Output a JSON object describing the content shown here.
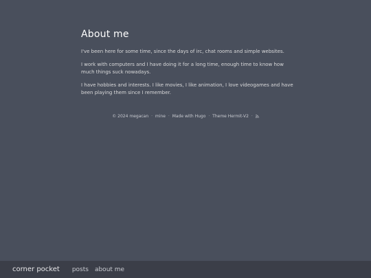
{
  "main": {
    "title": "About me",
    "paragraphs": [
      "I've been here for some time, since the days of irc, chat rooms and simple websites.",
      "I work with computers and I have doing it for a long time, enough time to know how much things suck nowadays.",
      "I have hobbies and interests. I like movies, I like animation, I love videogames and have been playing them since I remember."
    ]
  },
  "footer": {
    "copyright": "© 2024 megacan",
    "sep": "·",
    "mine": "mine",
    "made_with": "Made with Hugo",
    "theme": "Theme Hermit-V2"
  },
  "bottom_bar": {
    "site_title": "corner pocket",
    "nav": [
      "posts",
      "about me"
    ]
  },
  "icons": {
    "rss": "rss-icon"
  }
}
